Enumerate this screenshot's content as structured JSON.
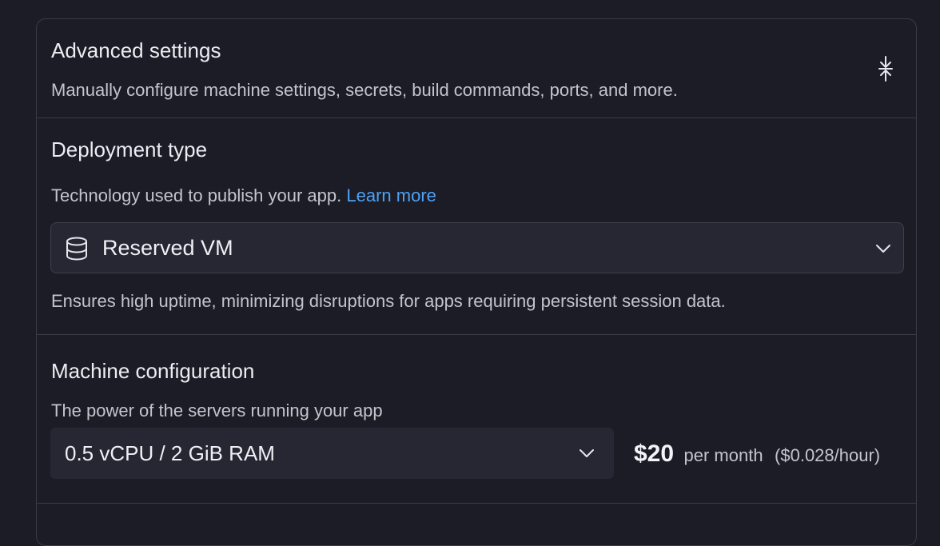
{
  "advanced": {
    "title": "Advanced settings",
    "description": "Manually configure machine settings, secrets, build commands, ports, and more.",
    "collapse_icon": "collapse-vertical-icon"
  },
  "deployment": {
    "title": "Deployment type",
    "description": "Technology used to publish your app.",
    "learn_more": "Learn more",
    "selected": "Reserved VM",
    "selected_icon": "database-icon",
    "note": "Ensures high uptime, minimizing disruptions for apps requiring persistent session data."
  },
  "machine": {
    "title": "Machine configuration",
    "description": "The power of the servers running your app",
    "selected": "0.5 vCPU / 2 GiB RAM",
    "price": "$20",
    "price_unit": "per month",
    "hourly": "($0.028/hour)"
  },
  "colors": {
    "background": "#1c1c26",
    "surface": "#262733",
    "border": "#3a3b47",
    "link": "#4ea1f5"
  }
}
